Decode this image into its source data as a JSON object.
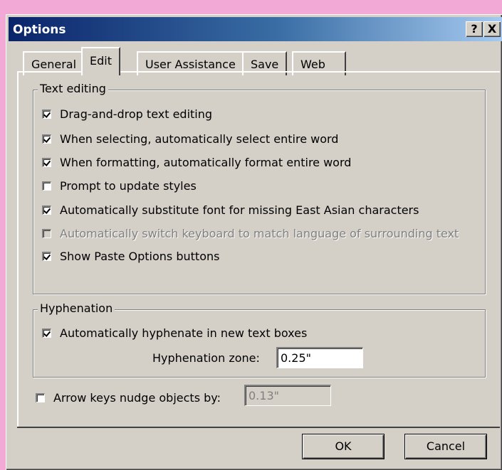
{
  "window": {
    "title": "Options",
    "help_label": "?",
    "close_label": "X"
  },
  "tabs": [
    {
      "label": "General",
      "active": false
    },
    {
      "label": "Edit",
      "active": true
    },
    {
      "label": "User Assistance",
      "active": false
    },
    {
      "label": "Save",
      "active": false
    },
    {
      "label": "Web",
      "active": false
    }
  ],
  "text_editing": {
    "legend": "Text editing",
    "options": [
      {
        "label": "Drag-and-drop text editing",
        "checked": true,
        "enabled": true
      },
      {
        "label": "When selecting, automatically select entire word",
        "checked": true,
        "enabled": true
      },
      {
        "label": "When formatting, automatically format entire word",
        "checked": true,
        "enabled": true
      },
      {
        "label": "Prompt to update styles",
        "checked": false,
        "enabled": true
      },
      {
        "label": "Automatically substitute font for missing East Asian characters",
        "checked": true,
        "enabled": true
      },
      {
        "label": "Automatically switch keyboard to match language of surrounding text",
        "checked": false,
        "enabled": false
      },
      {
        "label": "Show Paste Options buttons",
        "checked": true,
        "enabled": true
      }
    ]
  },
  "hyphenation": {
    "legend": "Hyphenation",
    "auto_label": "Automatically hyphenate in new text boxes",
    "auto_checked": true,
    "zone_label": "Hyphenation zone:",
    "zone_value": "0.25\""
  },
  "nudge": {
    "label": "Arrow keys nudge objects by:",
    "checked": false,
    "value": "0.13\""
  },
  "buttons": {
    "ok": "OK",
    "cancel": "Cancel"
  }
}
